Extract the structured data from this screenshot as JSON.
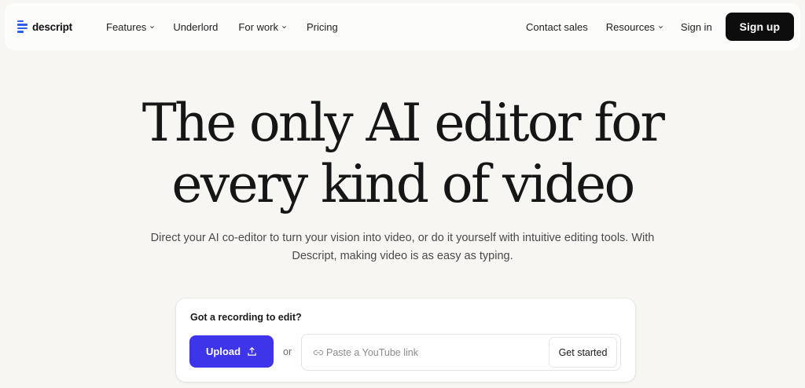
{
  "nav": {
    "logo_text": "descript",
    "brand_color": "#2f5bf0",
    "left_items": [
      {
        "label": "Features",
        "has_dropdown": true
      },
      {
        "label": "Underlord",
        "has_dropdown": false
      },
      {
        "label": "For work",
        "has_dropdown": true
      },
      {
        "label": "Pricing",
        "has_dropdown": false
      }
    ],
    "right_items": [
      {
        "label": "Contact sales",
        "has_dropdown": false
      },
      {
        "label": "Resources",
        "has_dropdown": true
      },
      {
        "label": "Sign in",
        "has_dropdown": false
      }
    ],
    "signup_label": "Sign up"
  },
  "hero": {
    "headline_line1": "The only AI editor for",
    "headline_line2": "every kind of video",
    "subtext_line1": "Direct your AI co-editor to turn your vision into video, or do it yourself with intuitive editing tools. With",
    "subtext_line2": "Descript, making video is as easy as typing."
  },
  "card": {
    "title": "Got a recording to edit?",
    "upload_label": "Upload",
    "or_label": "or",
    "link_placeholder": "Paste a YouTube link",
    "link_value": "",
    "get_started_label": "Get started",
    "accent_color": "#3e35ea"
  }
}
